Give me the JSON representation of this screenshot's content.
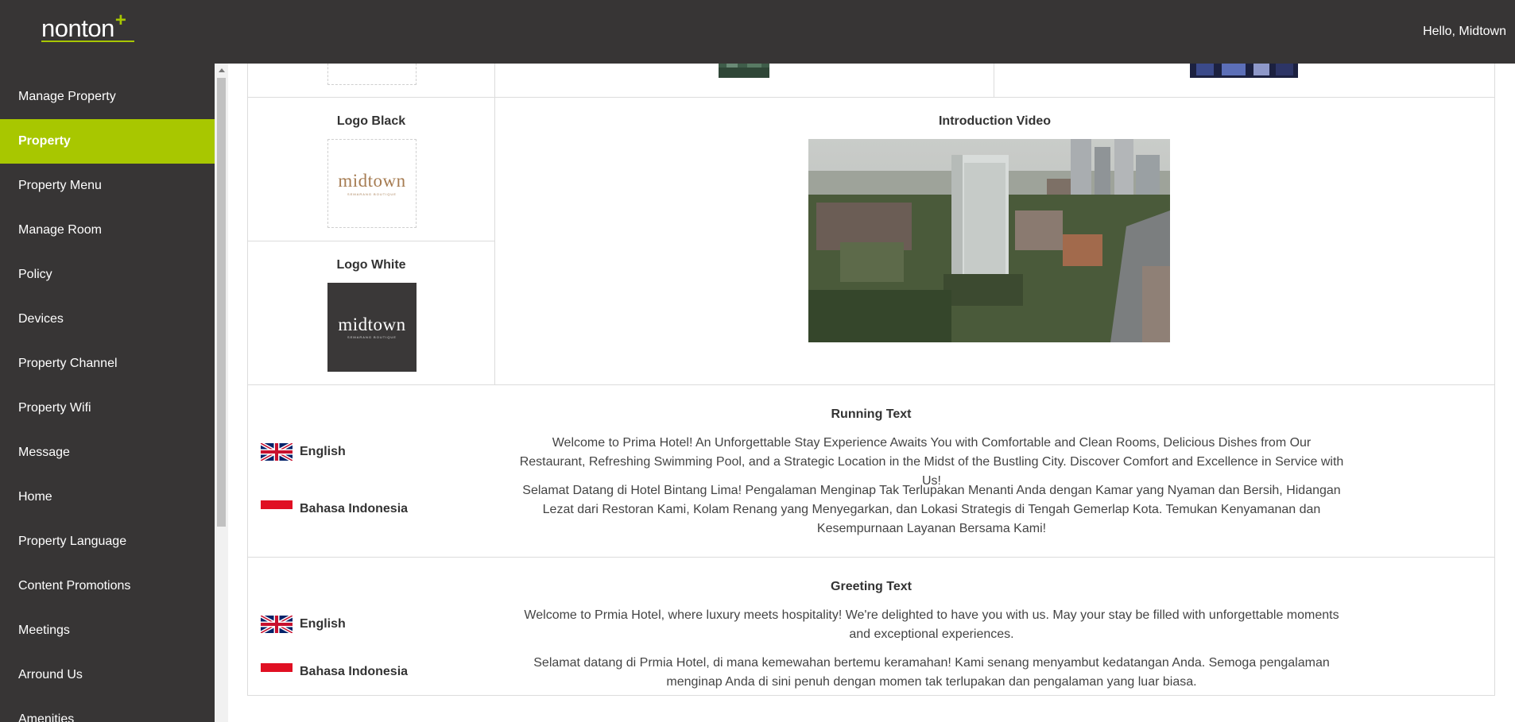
{
  "app": {
    "logo_text": "nonton",
    "logo_plus": "+",
    "greeting": "Hello, Midtown"
  },
  "sidebar": {
    "items": [
      {
        "label": "Manage Property",
        "active": false
      },
      {
        "label": "Property",
        "active": true
      },
      {
        "label": "Property Menu",
        "active": false
      },
      {
        "label": "Manage Room",
        "active": false
      },
      {
        "label": "Policy",
        "active": false
      },
      {
        "label": "Devices",
        "active": false
      },
      {
        "label": "Property Channel",
        "active": false
      },
      {
        "label": "Property Wifi",
        "active": false
      },
      {
        "label": "Message",
        "active": false
      },
      {
        "label": "Home",
        "active": false
      },
      {
        "label": "Property Language",
        "active": false
      },
      {
        "label": "Content Promotions",
        "active": false
      },
      {
        "label": "Meetings",
        "active": false
      },
      {
        "label": "Arround Us",
        "active": false
      },
      {
        "label": "Amenities",
        "active": false
      }
    ]
  },
  "media": {
    "logo_black": {
      "title": "Logo Black",
      "brand": "midtown",
      "brand_sub": "SEMARANG BOUTIQUE"
    },
    "logo_white": {
      "title": "Logo White",
      "brand": "midtown",
      "brand_sub": "SEMARANG BOUTIQUE"
    },
    "intro_video": {
      "title": "Introduction Video"
    }
  },
  "running_text": {
    "title": "Running Text",
    "languages": [
      {
        "label": "English",
        "flag": "uk-flag-icon",
        "text": "Welcome to Prima Hotel! An Unforgettable Stay Experience Awaits You with Comfortable and Clean Rooms, Delicious Dishes from Our Restaurant, Refreshing Swimming Pool, and a Strategic Location in the Midst of the Bustling City. Discover Comfort and Excellence in Service with Us!"
      },
      {
        "label": "Bahasa Indonesia",
        "flag": "indonesia-flag-icon",
        "text": "Selamat Datang di Hotel Bintang Lima! Pengalaman Menginap Tak Terlupakan Menanti Anda dengan Kamar yang Nyaman dan Bersih, Hidangan Lezat dari Restoran Kami, Kolam Renang yang Menyegarkan, dan Lokasi Strategis di Tengah Gemerlap Kota. Temukan Kenyamanan dan Kesempurnaan Layanan Bersama Kami!"
      }
    ]
  },
  "greeting_text": {
    "title": "Greeting Text",
    "languages": [
      {
        "label": "English",
        "flag": "uk-flag-icon",
        "text": "Welcome to Prmia Hotel, where luxury meets hospitality! We're delighted to have you with us. May your stay be filled with unforgettable moments and exceptional experiences."
      },
      {
        "label": "Bahasa Indonesia",
        "flag": "indonesia-flag-icon",
        "text": "Selamat datang di Prmia Hotel, di mana kemewahan bertemu keramahan! Kami senang menyambut kedatangan Anda. Semoga pengalaman menginap Anda di sini penuh dengan momen tak terlupakan dan pengalaman yang luar biasa."
      }
    ]
  },
  "colors": {
    "accent": "#a8c700",
    "sidebar_bg": "#373535",
    "topbar_bg": "#373535",
    "border": "#dcdcdc",
    "logo_brown": "#a67c52"
  }
}
